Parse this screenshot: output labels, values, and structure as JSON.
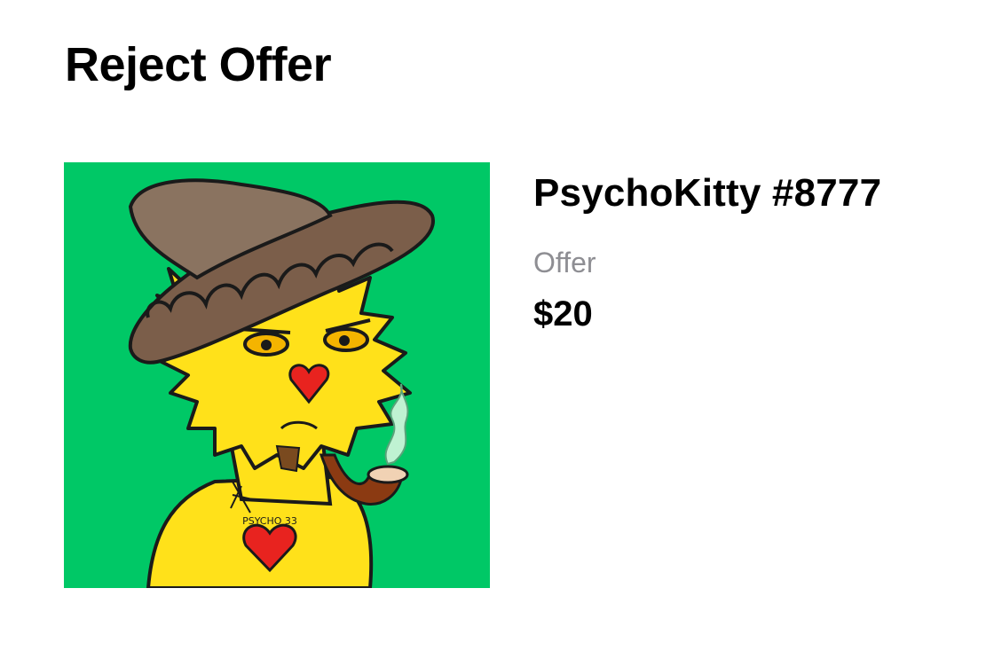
{
  "page": {
    "title": "Reject Offer"
  },
  "item": {
    "name": "PsychoKitty #8777",
    "image_background": "#00c866",
    "tattoo_text": "PSYCHO 33"
  },
  "offer": {
    "label": "Offer",
    "amount": "$20"
  },
  "colors": {
    "label_gray": "#8e8e93",
    "text": "#000000",
    "background": "#ffffff"
  }
}
